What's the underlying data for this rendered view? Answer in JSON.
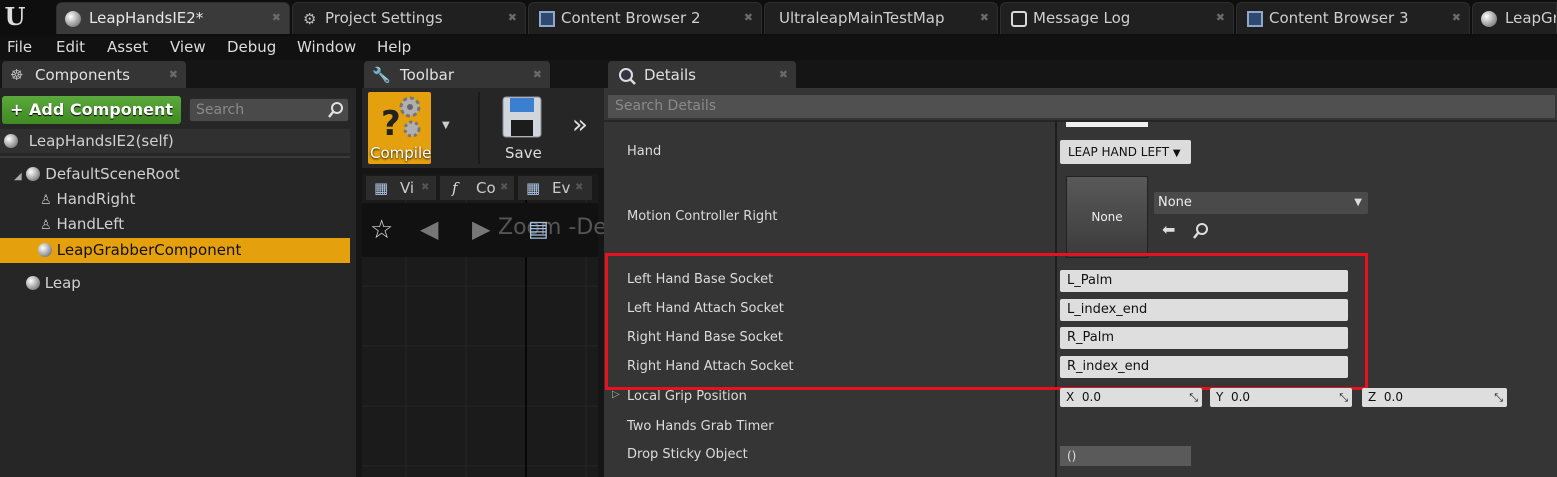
{
  "tabs": [
    {
      "label": "LeapHandsIE2*",
      "icon": "blueprint-icon"
    },
    {
      "label": "Project Settings",
      "icon": "settings-icon"
    },
    {
      "label": "Content Browser 2",
      "icon": "content-browser-icon"
    },
    {
      "label": "UltraleapMainTestMap",
      "icon": ""
    },
    {
      "label": "Message Log",
      "icon": "message-log-icon"
    },
    {
      "label": "Content Browser 3",
      "icon": "content-browser-icon"
    },
    {
      "label": "LeapGr",
      "icon": "blueprint-icon"
    }
  ],
  "menu": [
    "File",
    "Edit",
    "Asset",
    "View",
    "Debug",
    "Window",
    "Help"
  ],
  "components": {
    "title": "Components",
    "add_label": "Add Component",
    "search_placeholder": "Search",
    "self_label": "LeapHandsIE2(self)",
    "tree": [
      {
        "label": "DefaultSceneRoot",
        "selected": false
      },
      {
        "label": "HandRight",
        "selected": false
      },
      {
        "label": "HandLeft",
        "selected": false
      },
      {
        "label": "LeapGrabberComponent",
        "selected": true
      },
      {
        "label": "Leap",
        "selected": false
      }
    ]
  },
  "toolbar": {
    "title": "Toolbar",
    "compile_label": "Compile",
    "save_label": "Save",
    "graph_tabs": [
      "Vi",
      "Co",
      "Ev"
    ],
    "zoom_text": "Zoom -De"
  },
  "details": {
    "title": "Details",
    "search_placeholder": "Search Details",
    "hand_label": "Hand",
    "hand_value": "LEAP HAND LEFT",
    "motion_label": "Motion Controller Right",
    "motion_thumb": "None",
    "motion_value": "None",
    "sockets": [
      {
        "label": "Left Hand Base Socket",
        "value": "L_Palm"
      },
      {
        "label": "Left Hand Attach Socket",
        "value": "L_index_end"
      },
      {
        "label": "Right Hand Base Socket",
        "value": "R_Palm"
      },
      {
        "label": "Right Hand Attach Socket",
        "value": "R_index_end"
      }
    ],
    "grip_label": "Local Grip Position",
    "grip": {
      "x_label": "X",
      "x": "0.0",
      "y_label": "Y",
      "y": "0.0",
      "z_label": "Z",
      "z": "0.0"
    },
    "timer_label": "Two Hands Grab Timer",
    "sticky_label": "Drop Sticky Object",
    "sticky_value": "()"
  },
  "colors": {
    "highlight_box": "#e8121f",
    "selection": "#e5a00d",
    "add_button": "#4c9a2a"
  }
}
